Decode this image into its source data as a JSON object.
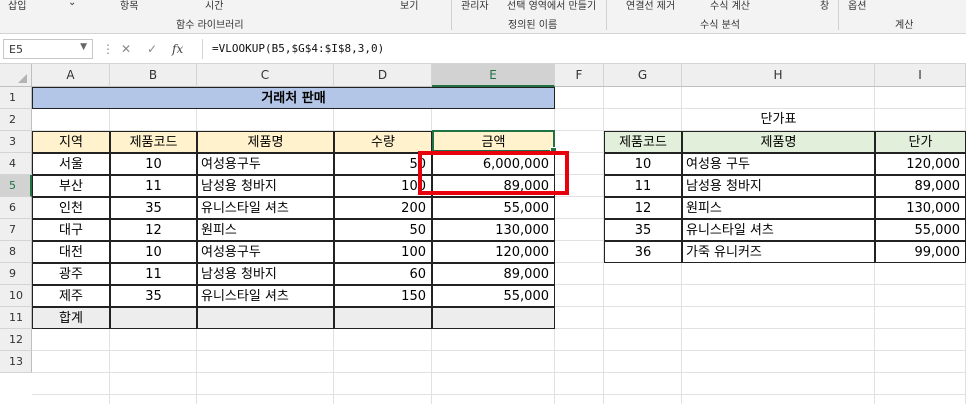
{
  "ribbon": {
    "items": [
      "삽입",
      "항목",
      "시간",
      "보기",
      "관리자",
      "선택 영역에서 만들기",
      "연결선 제거",
      "수식 계산",
      "창",
      "옵션"
    ],
    "groups": [
      "함수 라이브러리",
      "정의된 이름",
      "수식 분석",
      "계산"
    ]
  },
  "formula_bar": {
    "name_box": "E5",
    "fx": "fx",
    "formula": "=VLOOKUP(B5,$G$4:$I$8,3,0)"
  },
  "columns": [
    "A",
    "B",
    "C",
    "D",
    "E",
    "F",
    "G",
    "H",
    "I"
  ],
  "rows": [
    "1",
    "2",
    "3",
    "4",
    "5",
    "6",
    "7",
    "8",
    "9",
    "10",
    "11",
    "12",
    "13"
  ],
  "sales": {
    "title": "거래처 판매",
    "headers": [
      "지역",
      "제품코드",
      "제품명",
      "수량",
      "금액"
    ],
    "rows": [
      [
        "서울",
        "10",
        "여성용구두",
        "50",
        "6,000,000"
      ],
      [
        "부산",
        "11",
        "남성용 청바지",
        "100",
        "89,000"
      ],
      [
        "인천",
        "35",
        "유니스타일 셔츠",
        "200",
        "55,000"
      ],
      [
        "대구",
        "12",
        "원피스",
        "50",
        "130,000"
      ],
      [
        "대전",
        "10",
        "여성용구두",
        "100",
        "120,000"
      ],
      [
        "광주",
        "11",
        "남성용 청바지",
        "60",
        "89,000"
      ],
      [
        "제주",
        "35",
        "유니스타일 셔츠",
        "150",
        "55,000"
      ]
    ],
    "total_label": "합계"
  },
  "price_table": {
    "title": "단가표",
    "headers": [
      "제품코드",
      "제품명",
      "단가"
    ],
    "rows": [
      [
        "10",
        "여성용 구두",
        "120,000"
      ],
      [
        "11",
        "남성용 청바지",
        "89,000"
      ],
      [
        "12",
        "원피스",
        "130,000"
      ],
      [
        "35",
        "유니스타일 셔츠",
        "55,000"
      ],
      [
        "36",
        "가죽 유니커즈",
        "99,000"
      ]
    ]
  },
  "colors": {
    "title_fill": "#b4c6e7",
    "header_fill_sales": "#fff2cc",
    "header_fill_price": "#e2efda",
    "total_fill": "#ededed",
    "selection": "#217346",
    "highlight": "#e8000d"
  }
}
